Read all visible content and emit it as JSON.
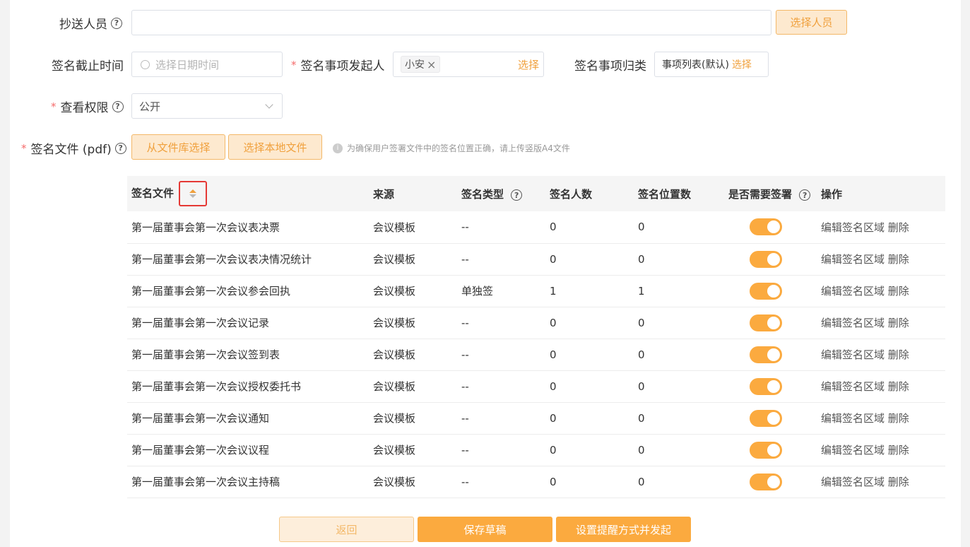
{
  "form": {
    "cc_label": "抄送人员",
    "cc_value": "",
    "cc_button": "选择人员",
    "deadline_label": "签名截止时间",
    "deadline_placeholder": "选择日期时间",
    "initiator_label": "签名事项发起人",
    "initiator_tag": "小安",
    "initiator_select": "选择",
    "category_label": "签名事项归类",
    "category_value": "事项列表(默认)",
    "category_select": "选择",
    "permission_label": "查看权限",
    "permission_value": "公开",
    "file_label": "签名文件 (pdf)",
    "file_library_button": "从文件库选择",
    "file_local_button": "选择本地文件",
    "file_hint": "为确保用户签署文件中的签名位置正确，请上传竖版A4文件"
  },
  "table": {
    "headers": {
      "file": "签名文件",
      "source": "来源",
      "type": "签名类型",
      "count": "签名人数",
      "positions": "签名位置数",
      "required": "是否需要签署",
      "ops": "操作"
    },
    "rows": [
      {
        "file": "第一届董事会第一次会议表决票",
        "source": "会议模板",
        "type": "--",
        "count": "0",
        "positions": "0",
        "required": true
      },
      {
        "file": "第一届董事会第一次会议表决情况统计",
        "source": "会议模板",
        "type": "--",
        "count": "0",
        "positions": "0",
        "required": true
      },
      {
        "file": "第一届董事会第一次会议参会回执",
        "source": "会议模板",
        "type": "单独签",
        "count": "1",
        "positions": "1",
        "required": true
      },
      {
        "file": "第一届董事会第一次会议记录",
        "source": "会议模板",
        "type": "--",
        "count": "0",
        "positions": "0",
        "required": true
      },
      {
        "file": "第一届董事会第一次会议签到表",
        "source": "会议模板",
        "type": "--",
        "count": "0",
        "positions": "0",
        "required": true
      },
      {
        "file": "第一届董事会第一次会议授权委托书",
        "source": "会议模板",
        "type": "--",
        "count": "0",
        "positions": "0",
        "required": true
      },
      {
        "file": "第一届董事会第一次会议通知",
        "source": "会议模板",
        "type": "--",
        "count": "0",
        "positions": "0",
        "required": true
      },
      {
        "file": "第一届董事会第一次会议议程",
        "source": "会议模板",
        "type": "--",
        "count": "0",
        "positions": "0",
        "required": true
      },
      {
        "file": "第一届董事会第一次会议主持稿",
        "source": "会议模板",
        "type": "--",
        "count": "0",
        "positions": "0",
        "required": true
      }
    ],
    "op_edit": "编辑签名区域",
    "op_delete": "删除"
  },
  "footer": {
    "back": "返回",
    "save_draft": "保存草稿",
    "set_reminder": "设置提醒方式并发起"
  },
  "colors": {
    "accent": "#fbaa3f",
    "accent_light": "#fde9cf",
    "required": "#f56c6c"
  }
}
